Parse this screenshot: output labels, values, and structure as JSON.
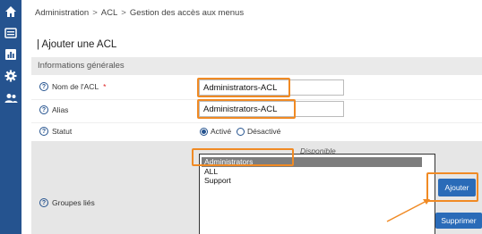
{
  "sidebar": {
    "icons": [
      "home-icon",
      "list-icon",
      "chart-icon",
      "gear-icon",
      "users-icon"
    ]
  },
  "breadcrumb": {
    "items": [
      "Administration",
      "ACL",
      "Gestion des accès aux menus"
    ],
    "separator": ">"
  },
  "page": {
    "title": "| Ajouter une ACL"
  },
  "section": {
    "title": "Informations générales"
  },
  "form": {
    "acl_name": {
      "label": "Nom de l'ACL",
      "required_mark": "*",
      "value": "Administrators-ACL"
    },
    "alias": {
      "label": "Alias",
      "value": "Administrators-ACL"
    },
    "status": {
      "label": "Statut",
      "options": [
        {
          "label": "Activé",
          "checked": true
        },
        {
          "label": "Désactivé",
          "checked": false
        }
      ]
    },
    "groups": {
      "label": "Groupes liés",
      "available_header": "Disponible",
      "available_items": [
        "Administrators",
        "ALL",
        "Support"
      ],
      "selected_item": "Administrators",
      "add_button": "Ajouter",
      "remove_button": "Supprimer"
    }
  },
  "colors": {
    "sidebar": "#25538f",
    "button": "#2a6bb8",
    "highlight": "#f08a24",
    "section_header": "#eaeaea"
  }
}
